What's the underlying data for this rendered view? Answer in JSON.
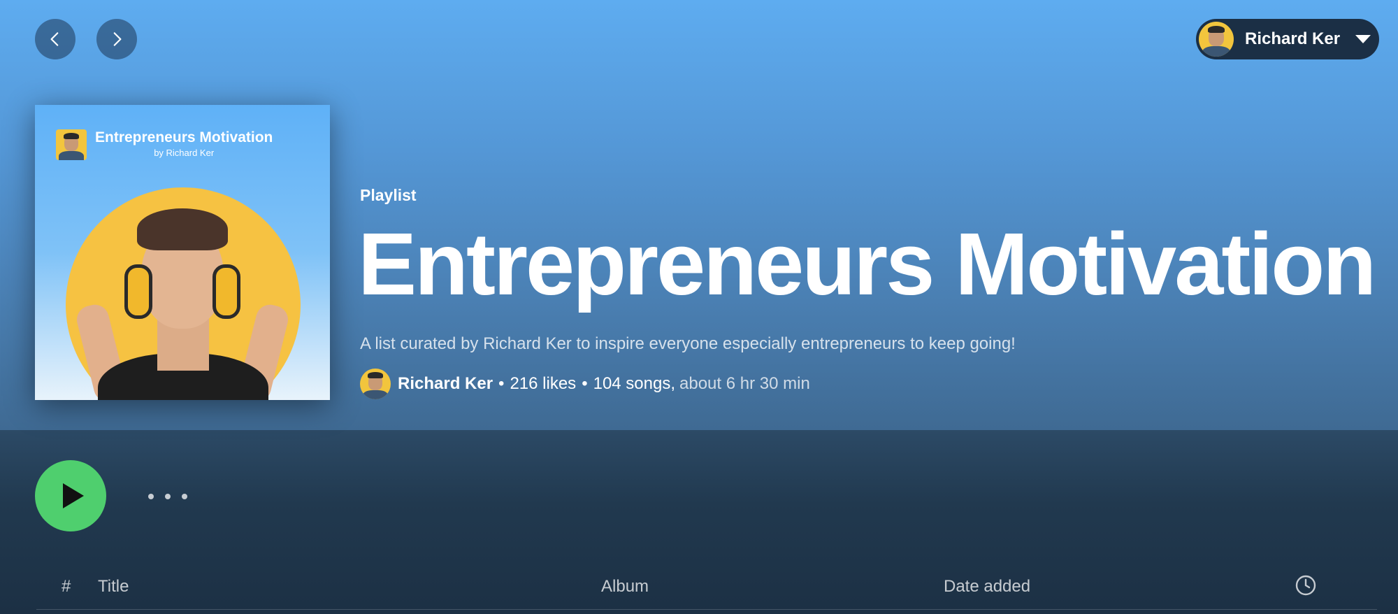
{
  "nav": {
    "back_icon": "chevron-left-icon",
    "forward_icon": "chevron-right-icon"
  },
  "user": {
    "name": "Richard Ker",
    "menu_icon": "caret-down-icon"
  },
  "cover": {
    "title": "Entrepreneurs Motivation",
    "subtitle": "by Richard Ker"
  },
  "playlist": {
    "type_label": "Playlist",
    "title": "Entrepreneurs Motivation",
    "description": "A list curated by Richard Ker to inspire everyone especially entrepreneurs to keep going!",
    "owner": "Richard Ker",
    "separator": "•",
    "likes": "216 likes",
    "songs": "104 songs,",
    "duration": "about 6 hr 30 min"
  },
  "controls": {
    "play_icon": "play-icon",
    "more_icon": "more-options-icon"
  },
  "table": {
    "col_num": "#",
    "col_title": "Title",
    "col_album": "Album",
    "col_date": "Date added",
    "col_duration_icon": "clock-icon"
  },
  "colors": {
    "hero_top": "#5eacf0",
    "lower_bg": "#1d3346",
    "play_green": "#4fcf6e",
    "pill_bg": "#1b2f45",
    "avatar_yellow": "#f2c53d"
  }
}
